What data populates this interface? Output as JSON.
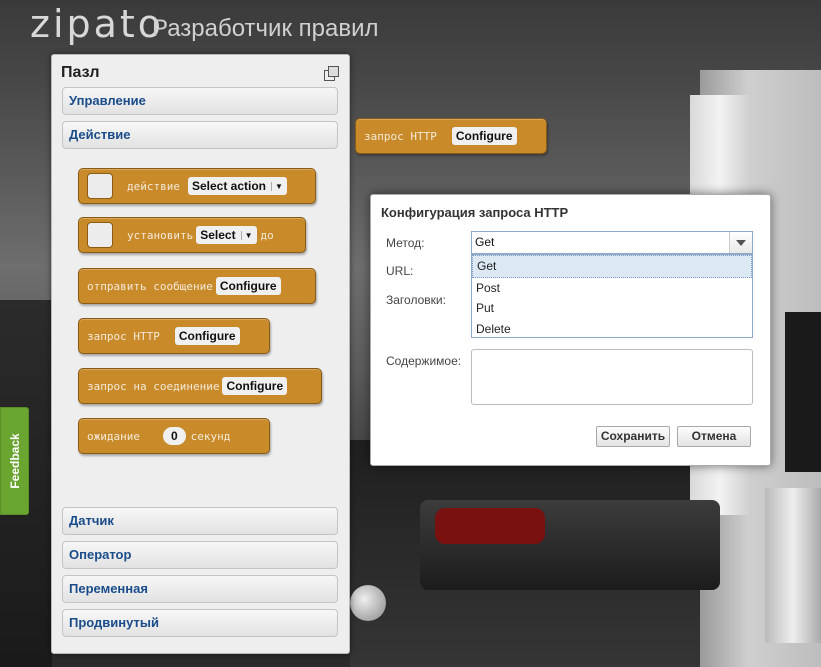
{
  "header": {
    "logo": "zipato",
    "title": "Разработчик правил"
  },
  "panel": {
    "title": "Пазл",
    "categories_top": [
      "Управление",
      "Действие"
    ],
    "categories_bottom": [
      "Датчик",
      "Оператор",
      "Переменная",
      "Продвинутый"
    ]
  },
  "blocks": {
    "action": {
      "label": "действие",
      "field": "Select action"
    },
    "set": {
      "label": "установить",
      "field": "Select",
      "suffix": "до"
    },
    "send_message": {
      "label": "отправить сообщение",
      "button": "Configure"
    },
    "http": {
      "label": "запрос HTTP",
      "button": "Configure"
    },
    "connection": {
      "label": "запрос на соединение",
      "button": "Configure"
    },
    "wait": {
      "label": "ожидание",
      "value": "0",
      "suffix": "секунд"
    }
  },
  "canvas_block": {
    "label": "запрос HTTP",
    "button": "Configure"
  },
  "dialog": {
    "title": "Конфигурация запроса HTTP",
    "labels": {
      "method": "Метод:",
      "url": "URL:",
      "headers": "Заголовки:",
      "content": "Содержимое:"
    },
    "method_value": "Get",
    "method_options": [
      "Get",
      "Post",
      "Put",
      "Delete"
    ],
    "save_label": "Сохранить",
    "cancel_label": "Отмена"
  },
  "feedback_label": "Feedback",
  "colors": {
    "block": "#c98a2a",
    "category_text": "#1a4c8a",
    "feedback": "#6aa531"
  }
}
